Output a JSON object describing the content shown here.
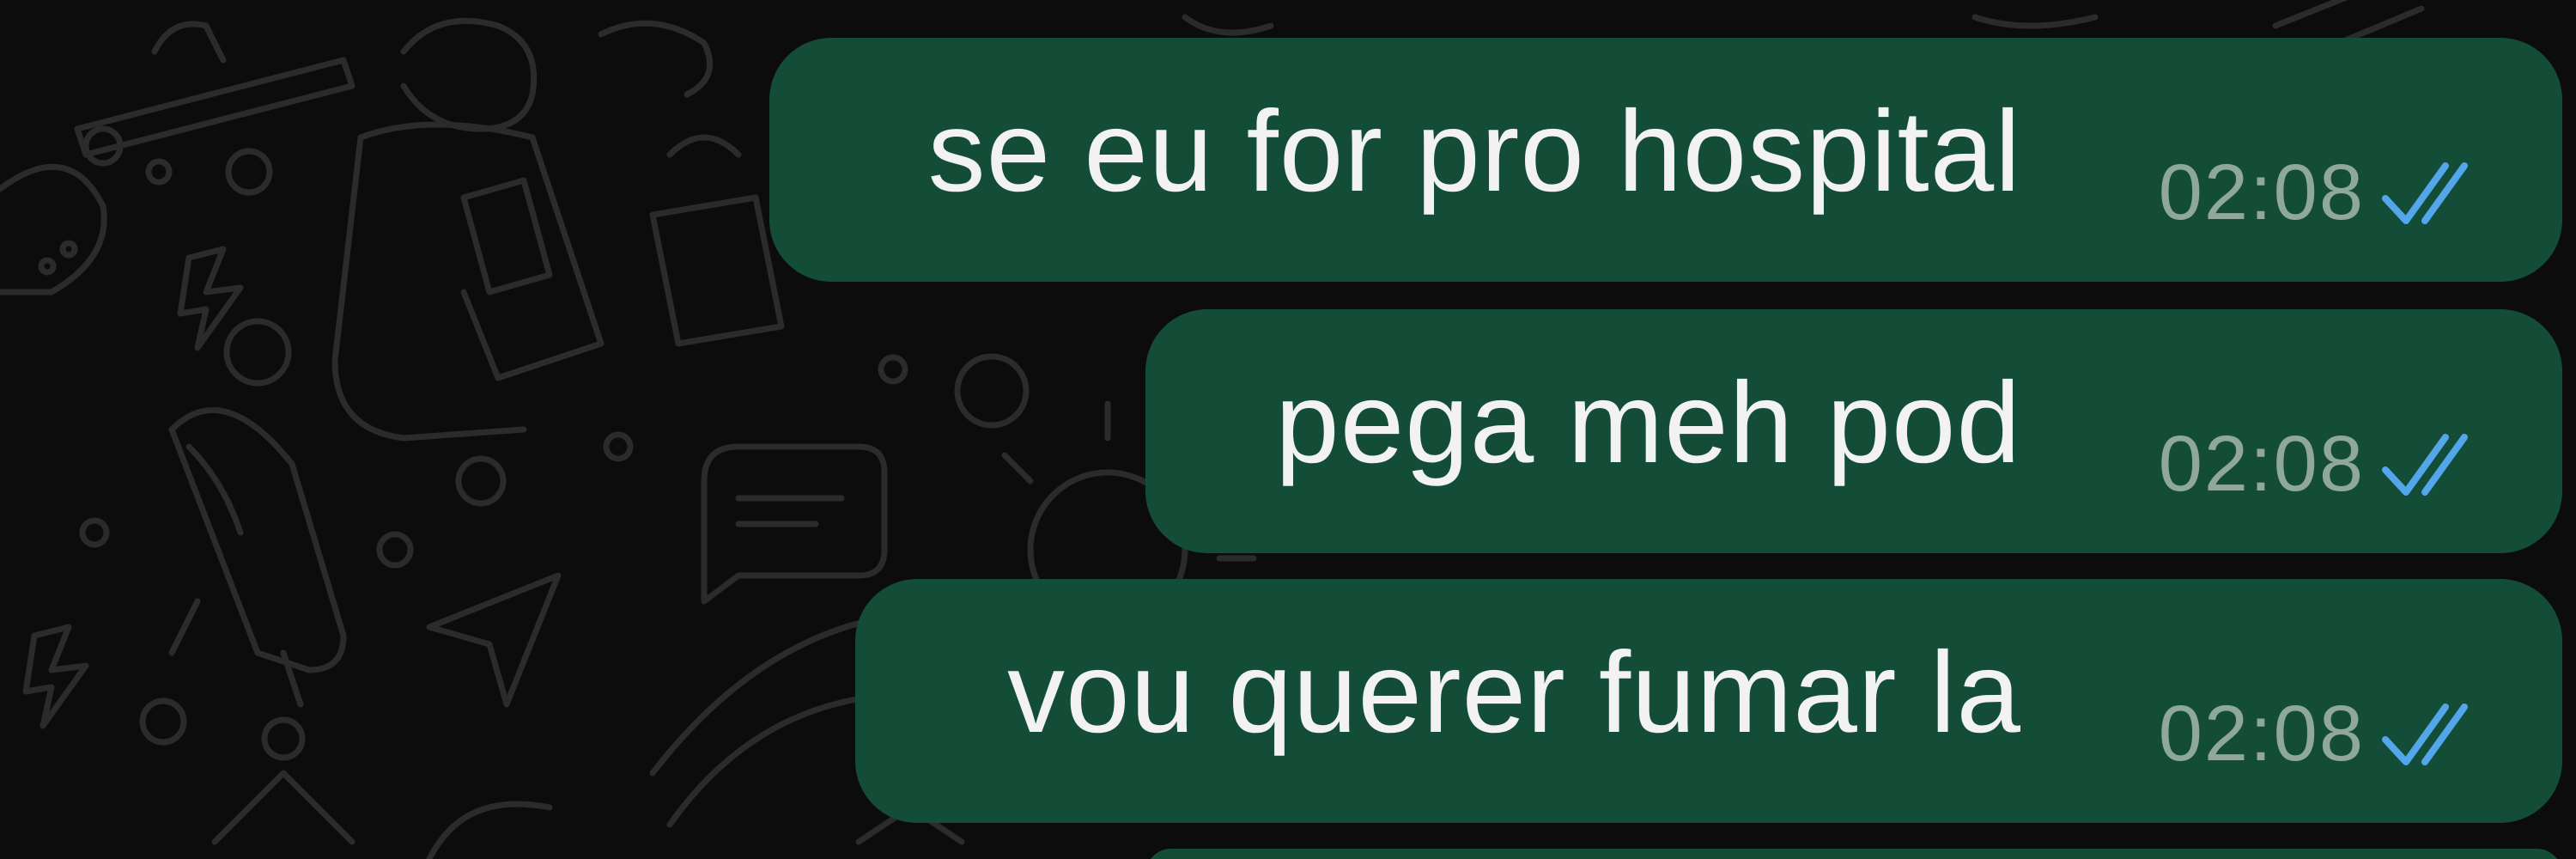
{
  "chat": {
    "messages": [
      {
        "text": "se eu for pro hospital",
        "time": "02:08",
        "status_icon": "double-check-read-icon"
      },
      {
        "text": "pega meh pod",
        "time": "02:08",
        "status_icon": "double-check-read-icon"
      },
      {
        "text": "vou querer fumar la",
        "time": "02:08",
        "status_icon": "double-check-read-icon"
      }
    ]
  },
  "colors": {
    "background": "#0c0c0c",
    "bubble": "#144d37",
    "text": "#f2f2f2",
    "timestamp": "#8fa89a",
    "read_ticks": "#53a6ea",
    "wallpaper_doodle": "#2a2a2a"
  }
}
